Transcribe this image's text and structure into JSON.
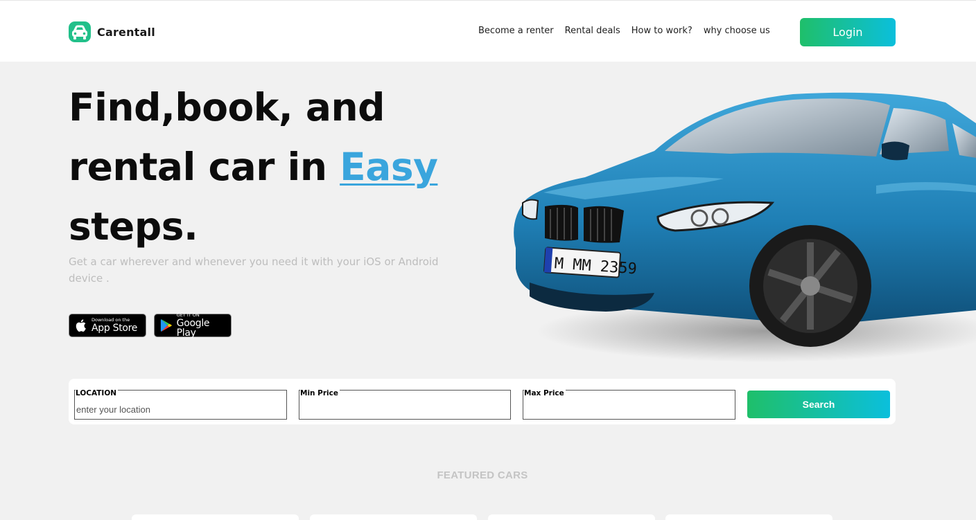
{
  "brand": {
    "name": "Carentall",
    "logo_icon": "car-front-icon",
    "accent": "#22c08a"
  },
  "nav": {
    "links": [
      {
        "label": "Become a renter"
      },
      {
        "label": "Rental deals"
      },
      {
        "label": "How to work?"
      },
      {
        "label": "why choose us"
      }
    ],
    "login_label": "Login"
  },
  "hero": {
    "title_line1": "Find,book, and",
    "title_line2_prefix": "rental car in ",
    "title_accent": "Easy",
    "title_line3": "steps.",
    "subtitle": "Get a car wherever and whenever you need it with your iOS or Android device .",
    "accent_color": "#3aa5dd",
    "car_plate": "M MM 2359"
  },
  "badges": {
    "apple": {
      "small": "Download on the",
      "big": "App Store",
      "icon": "apple-icon"
    },
    "google": {
      "small": "GET IT ON",
      "big": "Google Play",
      "icon": "google-play-icon"
    }
  },
  "search": {
    "location_label": "LOCATION",
    "location_placeholder": "enter your location",
    "min_price_label": "Min Price",
    "max_price_label": "Max Price",
    "button_label": "Search"
  },
  "featured": {
    "heading": "FEATURED CARS"
  },
  "colors": {
    "gradient_start": "#1fbf6a",
    "gradient_end": "#0bbfdc",
    "background": "#f1f1f1"
  }
}
